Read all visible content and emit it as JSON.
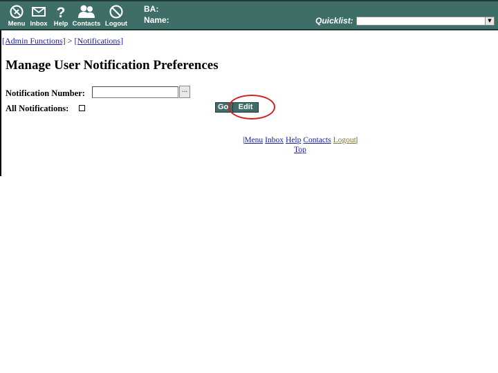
{
  "header": {
    "nav": [
      {
        "label": "Menu",
        "icon": "menu-circle-icon"
      },
      {
        "label": "Inbox",
        "icon": "envelope-icon"
      },
      {
        "label": "Help",
        "icon": "question-icon"
      },
      {
        "label": "Contacts",
        "icon": "people-icon"
      },
      {
        "label": "Logout",
        "icon": "no-symbol-icon"
      }
    ],
    "ba_label": "BA:",
    "name_label": "Name:",
    "quicklist_label": "Quicklist:",
    "quicklist_value": "",
    "color": "#3f6e69"
  },
  "breadcrumb": {
    "admin_functions": "[Admin Functions]",
    "separator": ">",
    "notifications": "[Notifications]"
  },
  "page_title": "Manage User Notification Preferences",
  "form": {
    "notification_number_label": "Notification Number:",
    "notification_number_value": "",
    "lookup_label": "...",
    "all_notifications_label": "All Notifications:",
    "all_notifications_checked": false,
    "go_label": "Go",
    "edit_label": "Edit"
  },
  "footer": {
    "links": [
      "Menu",
      "Inbox",
      "Help",
      "Contacts",
      "Logout"
    ],
    "top_link": "Top"
  },
  "annotation": {
    "highlight_color": "#d41d1d",
    "highlights": "edit-button"
  }
}
